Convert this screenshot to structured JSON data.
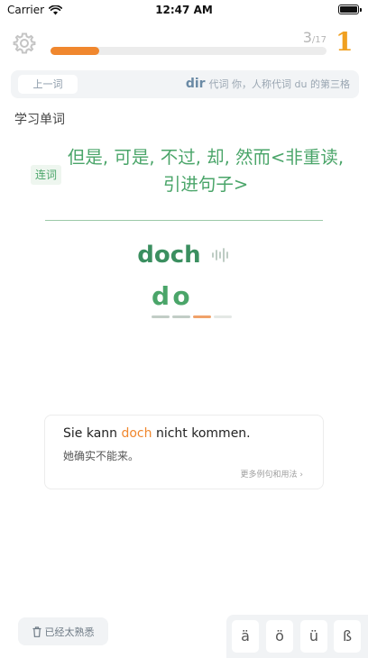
{
  "status_bar": {
    "carrier": "Carrier",
    "time": "12:47 AM"
  },
  "progress": {
    "current": "3",
    "total": "/17",
    "fraction": 0.176,
    "streak": "1"
  },
  "previous": {
    "button_label": "上一词",
    "word": "dir",
    "definition": "代词 你，人称代词 du 的第三格"
  },
  "section_title": "学习单词",
  "card": {
    "part_of_speech": "连词",
    "meaning": "但是, 可是, 不过, 却, 然而<非重读, 引进句子>",
    "word": "doch",
    "typed_letters": [
      "d",
      "o",
      "",
      ""
    ]
  },
  "example": {
    "before": "Sie kann ",
    "highlight": "doch",
    "after": " nicht kommen.",
    "translation": "她确实不能来。",
    "more_label": "更多例句和用法 ›"
  },
  "bottom": {
    "known_label": "已经太熟悉",
    "keys": [
      "ä",
      "ö",
      "ü",
      "ß"
    ]
  },
  "colors": {
    "accent_green": "#4aa569",
    "accent_orange": "#f0872e",
    "streak": "#f0a020"
  }
}
